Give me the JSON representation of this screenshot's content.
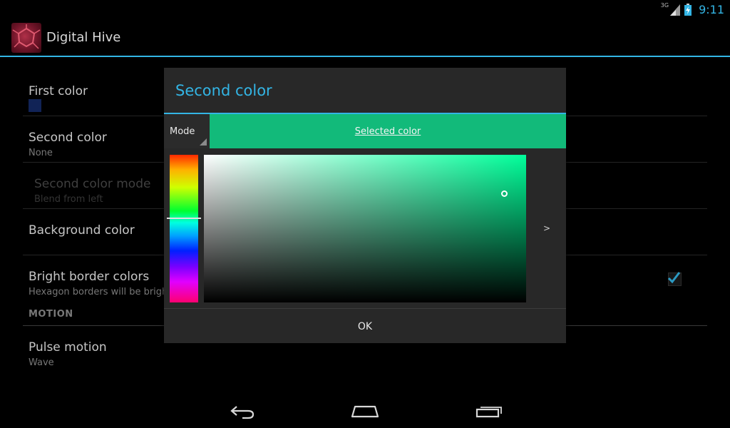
{
  "status_bar": {
    "network": "3G",
    "time": "9:11",
    "icons": [
      "signal-icon",
      "battery-charging-icon"
    ]
  },
  "action_bar": {
    "app_title": "Digital Hive",
    "icon": "digital-hive-app-icon"
  },
  "preferences": [
    {
      "title": "First color",
      "summary": "",
      "swatch_color": "#142a66",
      "enabled": true
    },
    {
      "title": "Second color",
      "summary": "None",
      "enabled": true
    },
    {
      "title": "Second color mode",
      "summary": "Blend from left",
      "enabled": false
    },
    {
      "title": "Background color",
      "summary": "",
      "enabled": true
    },
    {
      "title": "Bright border colors",
      "summary": "Hexagon borders will be bright.",
      "checked": true,
      "enabled": true
    }
  ],
  "category": {
    "title": "MOTION"
  },
  "motion_preferences": [
    {
      "title": "Pulse motion",
      "summary": "Wave",
      "enabled": true
    }
  ],
  "dialog": {
    "title": "Second color",
    "mode_label": "Mode",
    "selected_color_label": "Selected color",
    "selected_color": "#12ba7a",
    "hue_fraction": 0.43,
    "saturation": 0.93,
    "value": 0.73,
    "expand_label": ">",
    "ok_label": "OK"
  },
  "colors": {
    "accent": "#33b5e5",
    "background": "#000000",
    "dialog_background": "#282828"
  },
  "navigation": {
    "buttons": [
      "back-icon",
      "home-icon",
      "recents-icon"
    ]
  }
}
